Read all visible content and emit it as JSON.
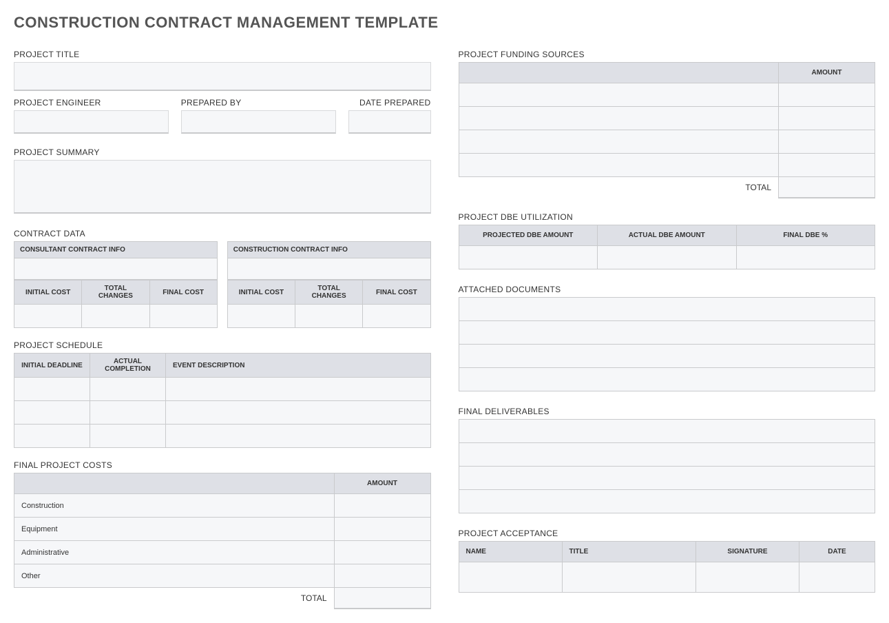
{
  "title": "CONSTRUCTION CONTRACT MANAGEMENT TEMPLATE",
  "left": {
    "project_title_label": "PROJECT TITLE",
    "engineer_label": "PROJECT ENGINEER",
    "prepared_by_label": "PREPARED BY",
    "date_prepared_label": "DATE PREPARED",
    "summary_label": "PROJECT SUMMARY",
    "contract_data_label": "CONTRACT DATA",
    "consultant_header": "CONSULTANT CONTRACT INFO",
    "construction_header": "CONSTRUCTION CONTRACT INFO",
    "initial_cost": "INITIAL COST",
    "total_changes": "TOTAL CHANGES",
    "final_cost": "FINAL COST",
    "schedule_label": "PROJECT SCHEDULE",
    "schedule_cols": {
      "c1": "INITIAL DEADLINE",
      "c2": "ACTUAL COMPLETION",
      "c3": "EVENT DESCRIPTION"
    },
    "final_costs_label": "FINAL PROJECT COSTS",
    "amount": "AMOUNT",
    "cost_rows": {
      "r1": "Construction",
      "r2": "Equipment",
      "r3": "Administrative",
      "r4": "Other"
    },
    "total": "TOTAL"
  },
  "right": {
    "funding_label": "PROJECT FUNDING SOURCES",
    "amount": "AMOUNT",
    "total": "TOTAL",
    "dbe_label": "PROJECT DBE UTILIZATION",
    "dbe_cols": {
      "c1": "PROJECTED DBE AMOUNT",
      "c2": "ACTUAL DBE AMOUNT",
      "c3": "FINAL DBE %"
    },
    "docs_label": "ATTACHED DOCUMENTS",
    "deliverables_label": "FINAL DELIVERABLES",
    "acceptance_label": "PROJECT ACCEPTANCE",
    "accept_cols": {
      "c1": "NAME",
      "c2": "TITLE",
      "c3": "SIGNATURE",
      "c4": "DATE"
    }
  }
}
